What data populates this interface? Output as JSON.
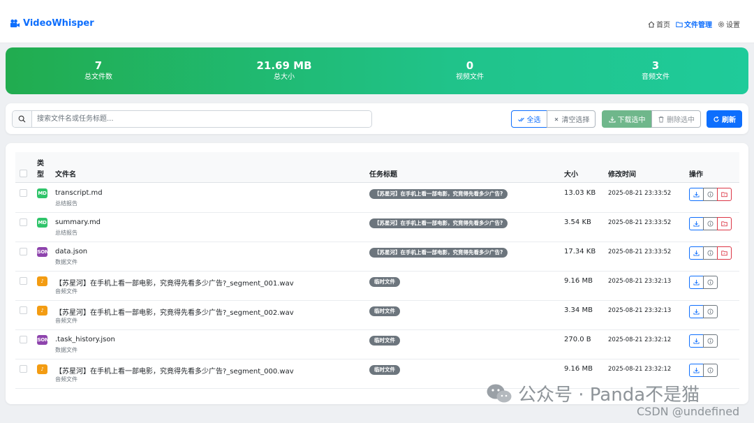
{
  "nav": {
    "brand": "VideoWhisper",
    "links": [
      {
        "label": "首页",
        "icon": "home-icon",
        "active": false
      },
      {
        "label": "文件管理",
        "icon": "folder-icon",
        "active": true
      },
      {
        "label": "设置",
        "icon": "gear-icon",
        "active": false
      }
    ]
  },
  "stats": [
    {
      "value": "7",
      "label": "总文件数"
    },
    {
      "value": "21.69 MB",
      "label": "总大小"
    },
    {
      "value": "0",
      "label": "视频文件"
    },
    {
      "value": "3",
      "label": "音频文件"
    }
  ],
  "toolbar": {
    "search_placeholder": "搜索文件名或任务标题...",
    "select_all": "全选",
    "clear_selection": "清空选择",
    "download_selected": "下载选中",
    "delete_selected": "删除选中",
    "refresh": "刷新"
  },
  "table": {
    "headers": {
      "type_line1": "类",
      "type_line2": "型",
      "name": "文件名",
      "task": "任务标题",
      "size": "大小",
      "mtime": "修改时间",
      "actions": "操作"
    },
    "rows": [
      {
        "type": "MD",
        "type_color": "#2fc46a",
        "name": "transcript.md",
        "sub": "总结报告",
        "task": "【苏星河】在手机上看一部电影，究竟得先看多少广告?",
        "size": "13.03 KB",
        "time": "2025-08-21 23:33:52",
        "deletable": true
      },
      {
        "type": "MD",
        "type_color": "#2fc46a",
        "name": "summary.md",
        "sub": "总结报告",
        "task": "【苏星河】在手机上看一部电影，究竟得先看多少广告?",
        "size": "3.54 KB",
        "time": "2025-08-21 23:33:52",
        "deletable": true
      },
      {
        "type": "JSON",
        "type_color": "#8e44ad",
        "name": "data.json",
        "sub": "数据文件",
        "task": "【苏星河】在手机上看一部电影，究竟得先看多少广告?",
        "size": "17.34 KB",
        "time": "2025-08-21 23:33:52",
        "deletable": true
      },
      {
        "type": "♪",
        "type_color": "#f39c12",
        "name": "【苏星河】在手机上看一部电影，究竟得先看多少广告?_segment_001.wav",
        "sub": "音频文件",
        "task": "临时文件",
        "size": "9.16 MB",
        "time": "2025-08-21 23:32:13",
        "deletable": false
      },
      {
        "type": "♪",
        "type_color": "#f39c12",
        "name": "【苏星河】在手机上看一部电影，究竟得先看多少广告?_segment_002.wav",
        "sub": "音频文件",
        "task": "临时文件",
        "size": "3.34 MB",
        "time": "2025-08-21 23:32:13",
        "deletable": false
      },
      {
        "type": "JSON",
        "type_color": "#8e44ad",
        "name": ".task_history.json",
        "sub": "数据文件",
        "task": "临时文件",
        "size": "270.0 B",
        "time": "2025-08-21 23:32:12",
        "deletable": false
      },
      {
        "type": "♪",
        "type_color": "#f39c12",
        "name": "【苏星河】在手机上看一部电影，究竟得先看多少广告?_segment_000.wav",
        "sub": "音频文件",
        "task": "临时文件",
        "size": "9.16 MB",
        "time": "2025-08-21 23:32:12",
        "deletable": false
      }
    ]
  },
  "watermark": {
    "text": "公众号 · Panda不是猫",
    "csdn": "CSDN @undefined"
  }
}
